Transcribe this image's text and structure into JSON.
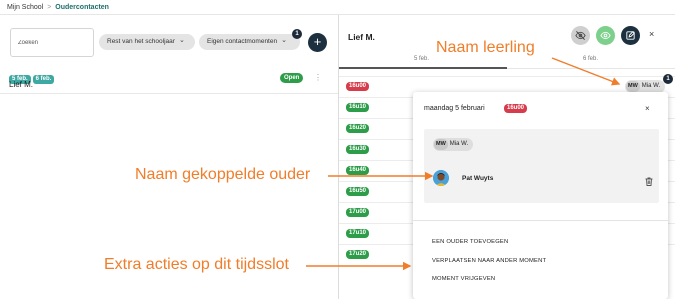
{
  "breadcrumb": {
    "root": "Mijn School",
    "separator": ">",
    "current": "Oudercontacten"
  },
  "left": {
    "search_placeholder": "Zoeken",
    "filters": [
      "Rest van het schooljaar",
      "Eigen contactmomenten"
    ],
    "filter_badge": "1",
    "add_label": "+",
    "dates": [
      "5 feb.",
      "6 feb."
    ],
    "student_name": "Lief M.",
    "status": "Open",
    "more": "⋮"
  },
  "right": {
    "title": "Lief M.",
    "columns": [
      "5 feb.",
      "6 feb."
    ],
    "close": "×",
    "slots": [
      {
        "time": "16u00",
        "status": "taken",
        "color": "#d63c4c"
      },
      {
        "time": "16u10",
        "status": "open",
        "color": "#2e9d4a"
      },
      {
        "time": "16u20",
        "status": "open",
        "color": "#2e9d4a"
      },
      {
        "time": "16u30",
        "status": "open",
        "color": "#2e9d4a"
      },
      {
        "time": "16u40",
        "status": "open",
        "color": "#2e9d4a"
      },
      {
        "time": "16u50",
        "status": "open",
        "color": "#2e9d4a"
      },
      {
        "time": "17u00",
        "status": "open",
        "color": "#2e9d4a"
      },
      {
        "time": "17u10",
        "status": "open",
        "color": "#2e9d4a"
      },
      {
        "time": "17u20",
        "status": "open",
        "color": "#2e9d4a"
      }
    ],
    "student_chip": {
      "initials": "MW",
      "name": "Mia W.",
      "badge": "1"
    }
  },
  "popover": {
    "date": "maandag 5 februari",
    "time": "16u00",
    "close": "×",
    "student_chip": {
      "initials": "MW",
      "name": "Mia W."
    },
    "parent_name": "Pat Wuyts",
    "actions": [
      "EEN OUDER TOEVOEGEN",
      "VERPLAATSEN NAAR ANDER MOMENT",
      "MOMENT VRIJGEVEN"
    ]
  },
  "annotations": {
    "student_name": "Naam leerling",
    "parent_name": "Naam gekoppelde ouder",
    "extra_actions": "Extra acties op dit tijdsslot",
    "color": "#f07d2a"
  }
}
